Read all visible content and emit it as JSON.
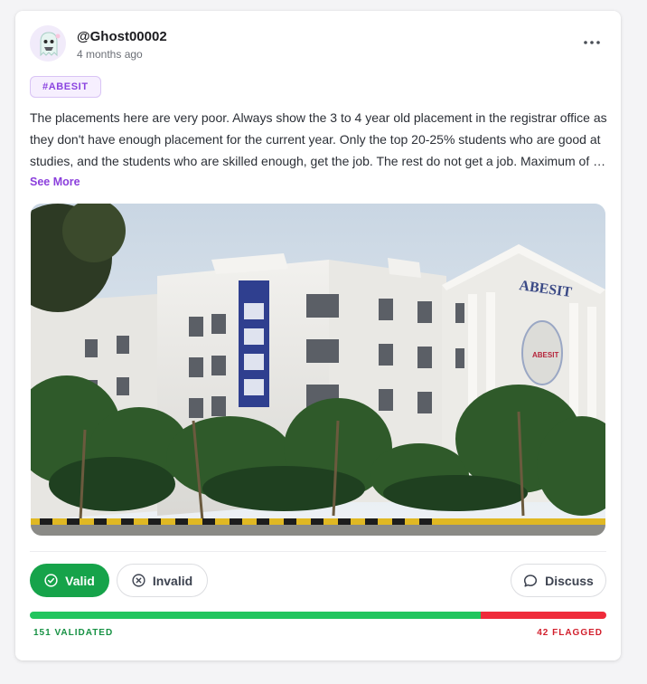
{
  "post": {
    "username": "@Ghost00002",
    "timestamp": "4 months ago",
    "tag": "#ABESIT",
    "body": "The placements here are very poor. Always show the 3 to 4 year old placement  in the registrar office as they don't have enough placement for the current year. Only the top 20-25% students who are good at studies, and the students who are skilled enough, get the job. The rest do not get a job. Maximum of …",
    "see_more": "See More",
    "image_sign_text": "ABESIT",
    "banner_text": "ABESIT"
  },
  "actions": {
    "valid_label": "Valid",
    "invalid_label": "Invalid",
    "discuss_label": "Discuss"
  },
  "stats": {
    "validated_label": "151 VALIDATED",
    "flagged_label": "42 FLAGGED",
    "validated_count": 151,
    "flagged_count": 42
  },
  "icons": {
    "more": "more-horizontal-icon",
    "valid": "check-circle-icon",
    "invalid": "x-circle-icon",
    "discuss": "chat-bubble-icon"
  },
  "colors": {
    "accent_purple": "#8b3fdc",
    "valid_green": "#16a34a",
    "flag_red": "#ef2b3a"
  }
}
